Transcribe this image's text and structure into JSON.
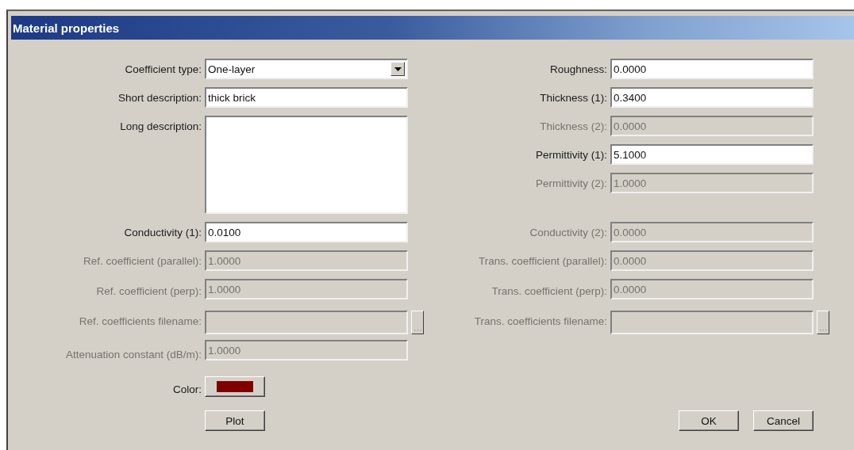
{
  "window": {
    "title": "Material properties"
  },
  "left_fields": [
    {
      "kind": "dropdown",
      "label": "Coefficient type:",
      "value": "One-layer",
      "disabled": false
    },
    {
      "kind": "text",
      "label": "Short description:",
      "value": "thick brick",
      "disabled": false
    },
    {
      "kind": "textarea",
      "label": "Long description:",
      "disabled": false
    },
    {
      "kind": "text",
      "label": "Conductivity (1):",
      "value": "0.0100",
      "disabled": false
    },
    {
      "kind": "text",
      "label": "Ref. coefficient (parallel):",
      "value": "1.0000",
      "disabled": true
    },
    {
      "kind": "text",
      "label": "Ref. coefficient (perp):",
      "value": "1.0000",
      "disabled": true
    },
    {
      "kind": "file",
      "label": "Ref. coefficients filename:",
      "disabled": true
    },
    {
      "kind": "text",
      "label": "Attenuation constant (dB/m):",
      "value": "1.0000",
      "disabled": true
    },
    {
      "kind": "color",
      "label": "Color:",
      "color": "#800000"
    }
  ],
  "right_fields": [
    {
      "kind": "text",
      "label": "Roughness:",
      "value": "0.0000",
      "disabled": false
    },
    {
      "kind": "text",
      "label": "Thickness (1):",
      "value": "0.3400",
      "disabled": false
    },
    {
      "kind": "text",
      "label": "Thickness (2):",
      "value": "0.0000",
      "disabled": true
    },
    {
      "kind": "text",
      "label": "Permittivity (1):",
      "value": "5.1000",
      "disabled": false
    },
    {
      "kind": "text",
      "label": "Permittivity (2):",
      "value": "1.0000",
      "disabled": true
    },
    {
      "kind": "text",
      "label": "Conductivity (2):",
      "value": "0.0000",
      "disabled": true
    },
    {
      "kind": "text",
      "label": "Trans. coefficient (parallel):",
      "value": "0.0000",
      "disabled": true
    },
    {
      "kind": "text",
      "label": "Trans. coefficient (perp):",
      "value": "0.0000",
      "disabled": true
    },
    {
      "kind": "file",
      "label": "Trans. coefficients filename:",
      "disabled": true
    }
  ],
  "buttons": [
    {
      "kind": "plot",
      "label": "Plot"
    },
    {
      "kind": "ok",
      "label": "OK"
    },
    {
      "kind": "cancel",
      "label": "Cancel"
    }
  ]
}
